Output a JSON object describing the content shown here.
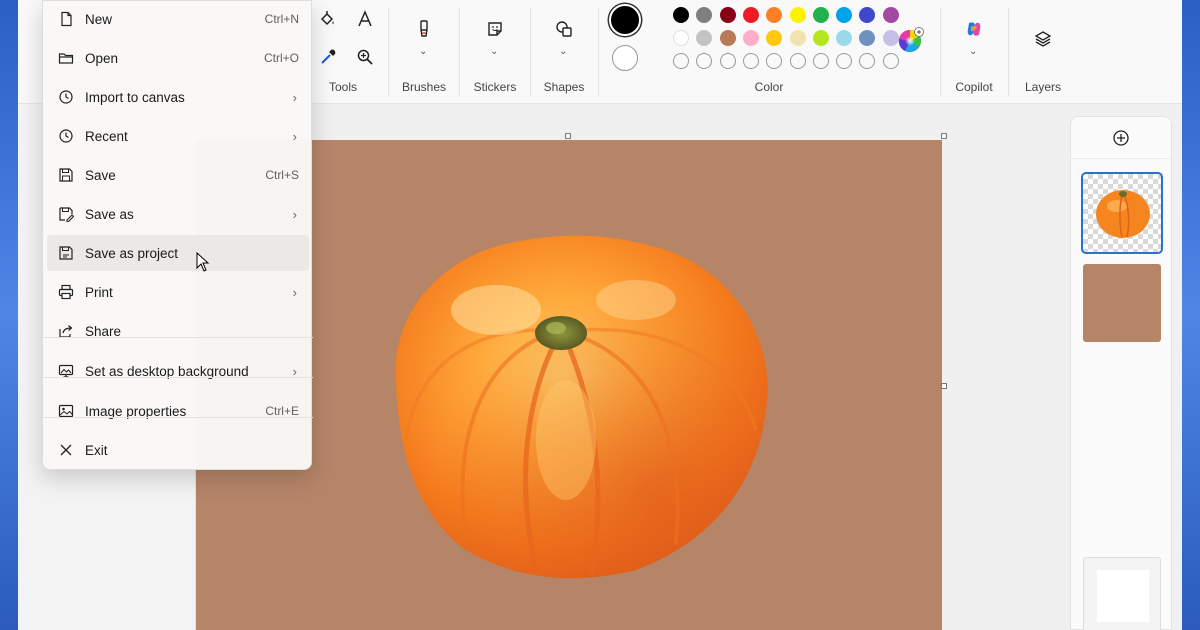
{
  "toolbar": {
    "groups": {
      "tools": "Tools",
      "brushes": "Brushes",
      "stickers": "Stickers",
      "shapes": "Shapes",
      "color": "Color",
      "copilot": "Copilot",
      "layers": "Layers"
    },
    "icons": {
      "fill": "paint-bucket-icon",
      "text": "text-icon",
      "picker": "color-picker-icon",
      "zoom": "magnifier-icon",
      "brush": "brush-icon",
      "sticker": "sticker-icon",
      "shape": "shapes-icon",
      "copilot": "copilot-icon",
      "layers": "layers-icon",
      "color_wheel": "color-wheel-icon"
    },
    "palette": {
      "primary_color": "#000000",
      "secondary_color": "#ffffff",
      "row1": [
        "#000000",
        "#7f7f7f",
        "#880015",
        "#ed1c24",
        "#ff7f27",
        "#fff200",
        "#22b14c",
        "#00a2e8",
        "#3f48cc",
        "#a349a4"
      ],
      "row2": [
        "#ffffff",
        "#c3c3c3",
        "#b97a57",
        "#ffaec9",
        "#ffc90e",
        "#efe4b0",
        "#b5e61d",
        "#99d9ea",
        "#7092be",
        "#c8bfe7"
      ]
    }
  },
  "file_menu": {
    "items": [
      {
        "label": "New",
        "icon": "new-file-icon",
        "shortcut": "Ctrl+N",
        "submenu": false
      },
      {
        "label": "Open",
        "icon": "folder-icon",
        "shortcut": "Ctrl+O",
        "submenu": false
      },
      {
        "label": "Import to canvas",
        "icon": "import-clock-icon",
        "shortcut": "",
        "submenu": true
      },
      {
        "label": "Recent",
        "icon": "clock-icon",
        "shortcut": "",
        "submenu": true
      },
      {
        "label": "Save",
        "icon": "save-icon",
        "shortcut": "Ctrl+S",
        "submenu": false
      },
      {
        "label": "Save as",
        "icon": "save-as-icon",
        "shortcut": "",
        "submenu": true
      },
      {
        "label": "Save as project",
        "icon": "save-project-icon",
        "shortcut": "",
        "submenu": false
      },
      {
        "label": "Print",
        "icon": "printer-icon",
        "shortcut": "",
        "submenu": true
      },
      {
        "label": "Share",
        "icon": "share-icon",
        "shortcut": "",
        "submenu": false
      },
      {
        "label": "Set as desktop background",
        "icon": "desktop-background-icon",
        "shortcut": "",
        "submenu": true
      },
      {
        "label": "Image properties",
        "icon": "image-properties-icon",
        "shortcut": "Ctrl+E",
        "submenu": false
      },
      {
        "label": "Exit",
        "icon": "close-icon",
        "shortcut": "",
        "submenu": false
      }
    ],
    "hovered": "Save as project",
    "arrow_glyph": "›"
  },
  "canvas": {
    "background_color": "#b68568",
    "subject": "pumpkin-painting"
  },
  "layers_panel": {
    "add_icon": "plus-circle-icon",
    "layers": [
      {
        "name": "pumpkin-layer",
        "selected": true
      },
      {
        "name": "background-layer",
        "selected": false
      }
    ]
  }
}
